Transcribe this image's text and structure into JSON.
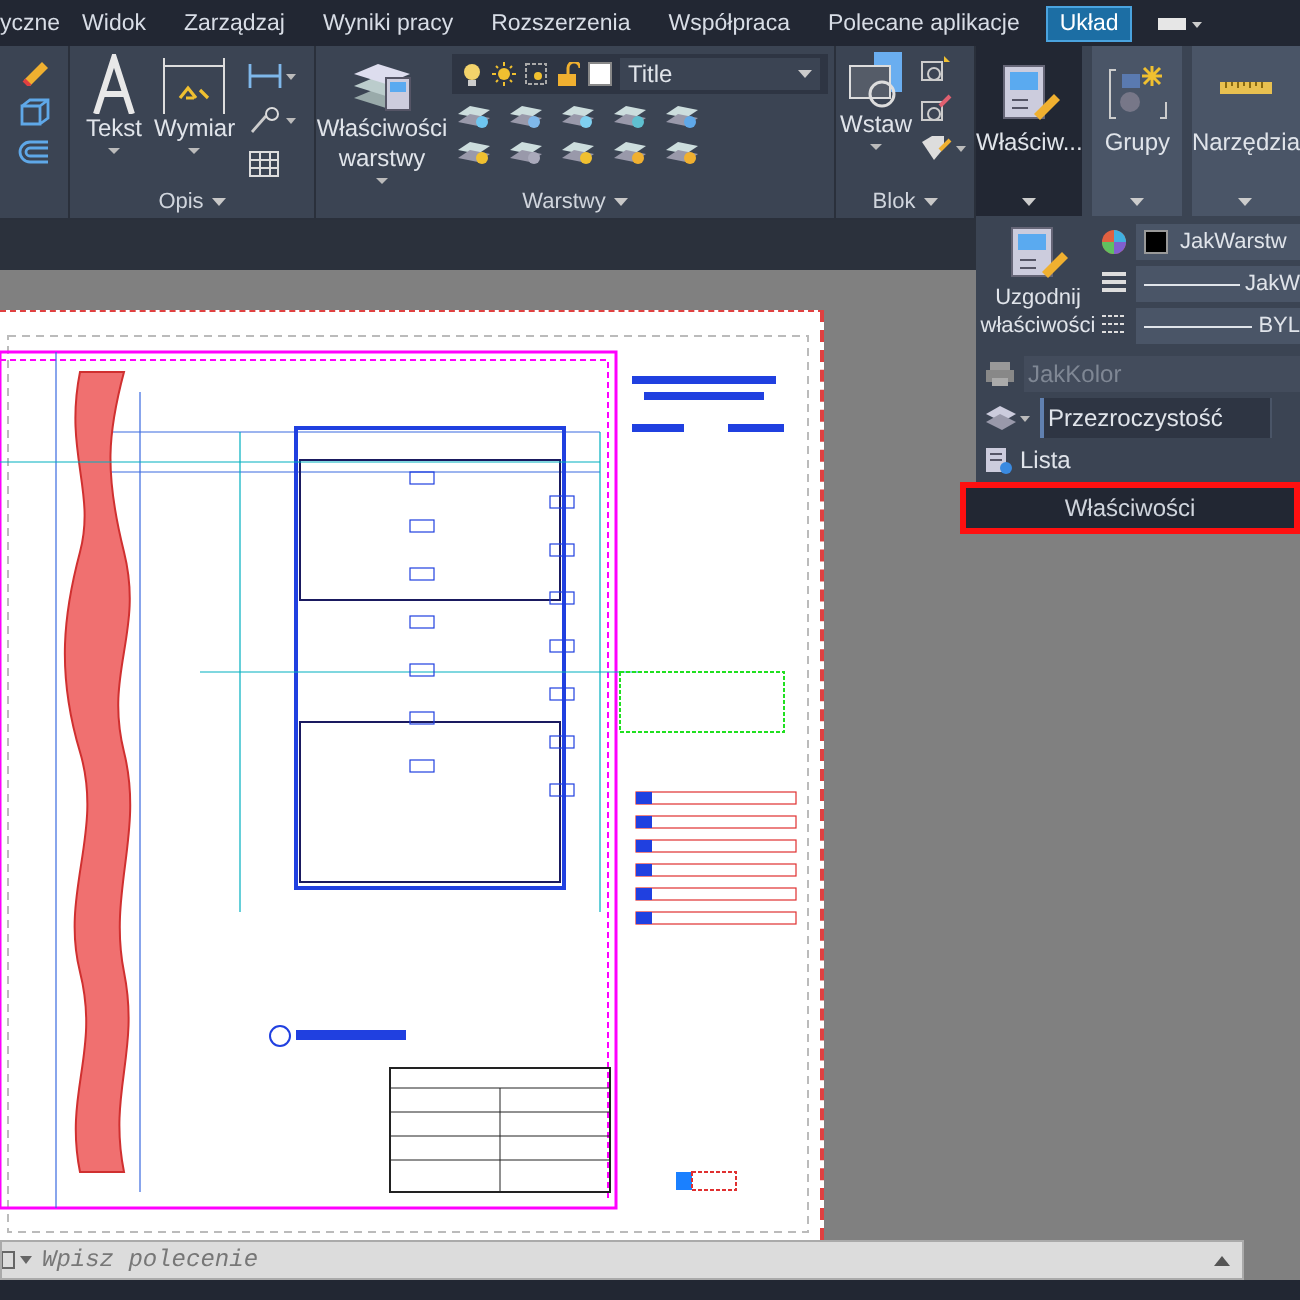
{
  "menu_tabs": [
    {
      "label": "yczne",
      "selected": false
    },
    {
      "label": "Widok",
      "selected": false
    },
    {
      "label": "Zarządzaj",
      "selected": false
    },
    {
      "label": "Wyniki pracy",
      "selected": false
    },
    {
      "label": "Rozszerzenia",
      "selected": false
    },
    {
      "label": "Współpraca",
      "selected": false
    },
    {
      "label": "Polecane aplikacje",
      "selected": false
    },
    {
      "label": "Układ",
      "selected": true
    }
  ],
  "ribbon": {
    "panels": [
      {
        "label": "Opis",
        "buttons": [
          "Tekst",
          "Wymiar"
        ]
      },
      {
        "label": "Warstwy",
        "buttons": [
          "Właściwości warstwy"
        ],
        "layer_dropdown": "Title"
      },
      {
        "label": "Blok",
        "buttons": [
          "Wstaw"
        ]
      }
    ],
    "large_buttons": [
      {
        "label": "Właściw...",
        "expanded": true
      },
      {
        "label": "Grupy",
        "expanded": false
      },
      {
        "label": "Narzędzia",
        "expanded": false
      }
    ]
  },
  "properties_panel": {
    "match_button": "Uzgodnij właściwości",
    "color_value": "JakWarstw",
    "linetype": "JakW",
    "lineweight": "BYL",
    "plot_style": {
      "value": "JakKolor",
      "disabled": true
    },
    "transparency": "Przezroczystość",
    "list_button": "Lista",
    "footer": {
      "label": "Właściwości",
      "highlighted": true
    }
  },
  "command_line": {
    "placeholder": "Wpisz polecenie"
  }
}
